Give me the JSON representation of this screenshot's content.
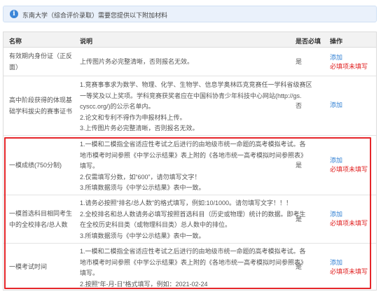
{
  "banner": {
    "icon": "info-icon",
    "text": "东南大学（综合评价录取）需要您提供以下附加材料"
  },
  "table": {
    "headers": {
      "name": "名称",
      "desc": "说明",
      "required": "是否必填",
      "action": "操作"
    },
    "rows": [
      {
        "name": [
          "有效期内身份证（正反",
          "面）"
        ],
        "desc": [
          "上传图片务必完整清晰，否则报名无效。"
        ],
        "required": "是",
        "add": "添加",
        "warn": "必填项未填写"
      },
      {
        "name": [
          "高中阶段获得的体现基",
          "础学科拔尖的赛事证书"
        ],
        "desc": [
          "1.竞赛事事求为数学、物理、化学、生物学、信息学奥林匹克竞赛任一学科省级赛区",
          "一等奖及以上奖项。学科竞赛获奖者应在中国科协青少年科技中心网站(http://gs.",
          "cyscc.org/)的公示名单内。",
          "2.论文和专利不得作为申报材料上传。",
          "3.上传图片务必完整清晰，否则报名无效。"
        ],
        "required": "否",
        "add": "添加",
        "warn": ""
      },
      {
        "name": [
          "一模成绩(750分制)"
        ],
        "desc": [
          "1.一模和二模指全省适应性考试之后进行的由地级市统一命题的高考模拟考试。各",
          "地市模考时间参照《中学公示结果》表上附的《各地市统一高考模拟时间参照表》",
          "填写。",
          "2.仅需填写分数，如“600”，请勿填写文字！",
          "3.所填数据须与《中学公示结果》表中一致。"
        ],
        "required": "是",
        "add": "添加",
        "warn": "必填项未填写"
      },
      {
        "name": [
          "一模首选科目相同考生",
          "中的全校排名/总人数"
        ],
        "desc": [
          "1.请务必按照“排名/总人数”的格式填写，例如:10/1000。请勿填写文字！！！",
          "2.全校排名和总人数请务必填写按照首选科目（历史或物理）统计的数据。即考生",
          "在全校历史科目类（或物理科目类）总人数中的排位。",
          "3.所填数据须与《中学公示结果》表中一致。"
        ],
        "required": "是",
        "add": "添加",
        "warn": "必填项未填写"
      },
      {
        "name": [
          "一模考试时间"
        ],
        "desc": [
          "1.一模和二模指全省适应性考试之后进行的由地级市统一命题的高考模拟考试。各",
          "地市模考时间参照《中学公示结果》表上附的《各地市统一高考模拟时间参照表》",
          "填写。",
          "2.按照“年-月-日”格式填写，例如：2021-02-24"
        ],
        "required": "是",
        "add": "添加",
        "warn": "必填项未填写"
      }
    ]
  },
  "colors": {
    "link": "#2f7fd3",
    "warn": "#e02020",
    "highlight": "#e5262a",
    "banner_bg": "#eaf1fb"
  }
}
